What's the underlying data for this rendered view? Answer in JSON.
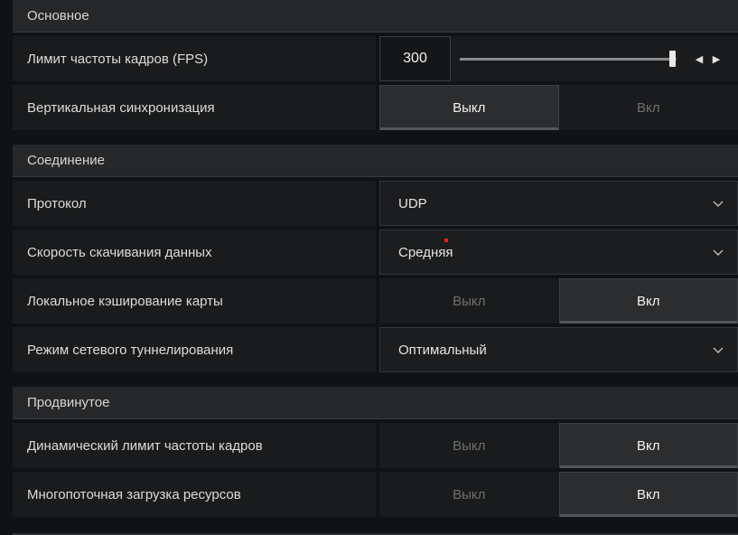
{
  "sections": {
    "basic": {
      "title": "Основное",
      "fps_limit": {
        "label": "Лимит частоты кадров (FPS)",
        "value": "300",
        "slider_fraction": 0.98
      },
      "vsync": {
        "label": "Вертикальная синхронизация",
        "off": "Выкл",
        "on": "Вкл",
        "selected": "off"
      }
    },
    "connection": {
      "title": "Соединение",
      "protocol": {
        "label": "Протокол",
        "value": "UDP"
      },
      "download_speed": {
        "label": "Скорость скачивания данных",
        "value": "Средняя"
      },
      "map_cache": {
        "label": "Локальное кэширование карты",
        "off": "Выкл",
        "on": "Вкл",
        "selected": "on"
      },
      "tunneling": {
        "label": "Режим сетевого туннелирования",
        "value": "Оптимальный"
      }
    },
    "advanced": {
      "title": "Продвинутое",
      "dynamic_fps": {
        "label": "Динамический лимит частоты кадров",
        "off": "Выкл",
        "on": "Вкл",
        "selected": "on"
      },
      "multithread_load": {
        "label": "Многопоточная загрузка ресурсов",
        "off": "Выкл",
        "on": "Вкл",
        "selected": "on"
      }
    }
  },
  "colors": {
    "background": "#111213",
    "row": "#1a1b1c",
    "header": "#262728",
    "active": "#2c2d2e",
    "accent_dot": "#e02020"
  },
  "icons": {
    "dropdown": "chevron-down-icon",
    "left": "arrow-left-icon",
    "right": "arrow-right-icon"
  }
}
